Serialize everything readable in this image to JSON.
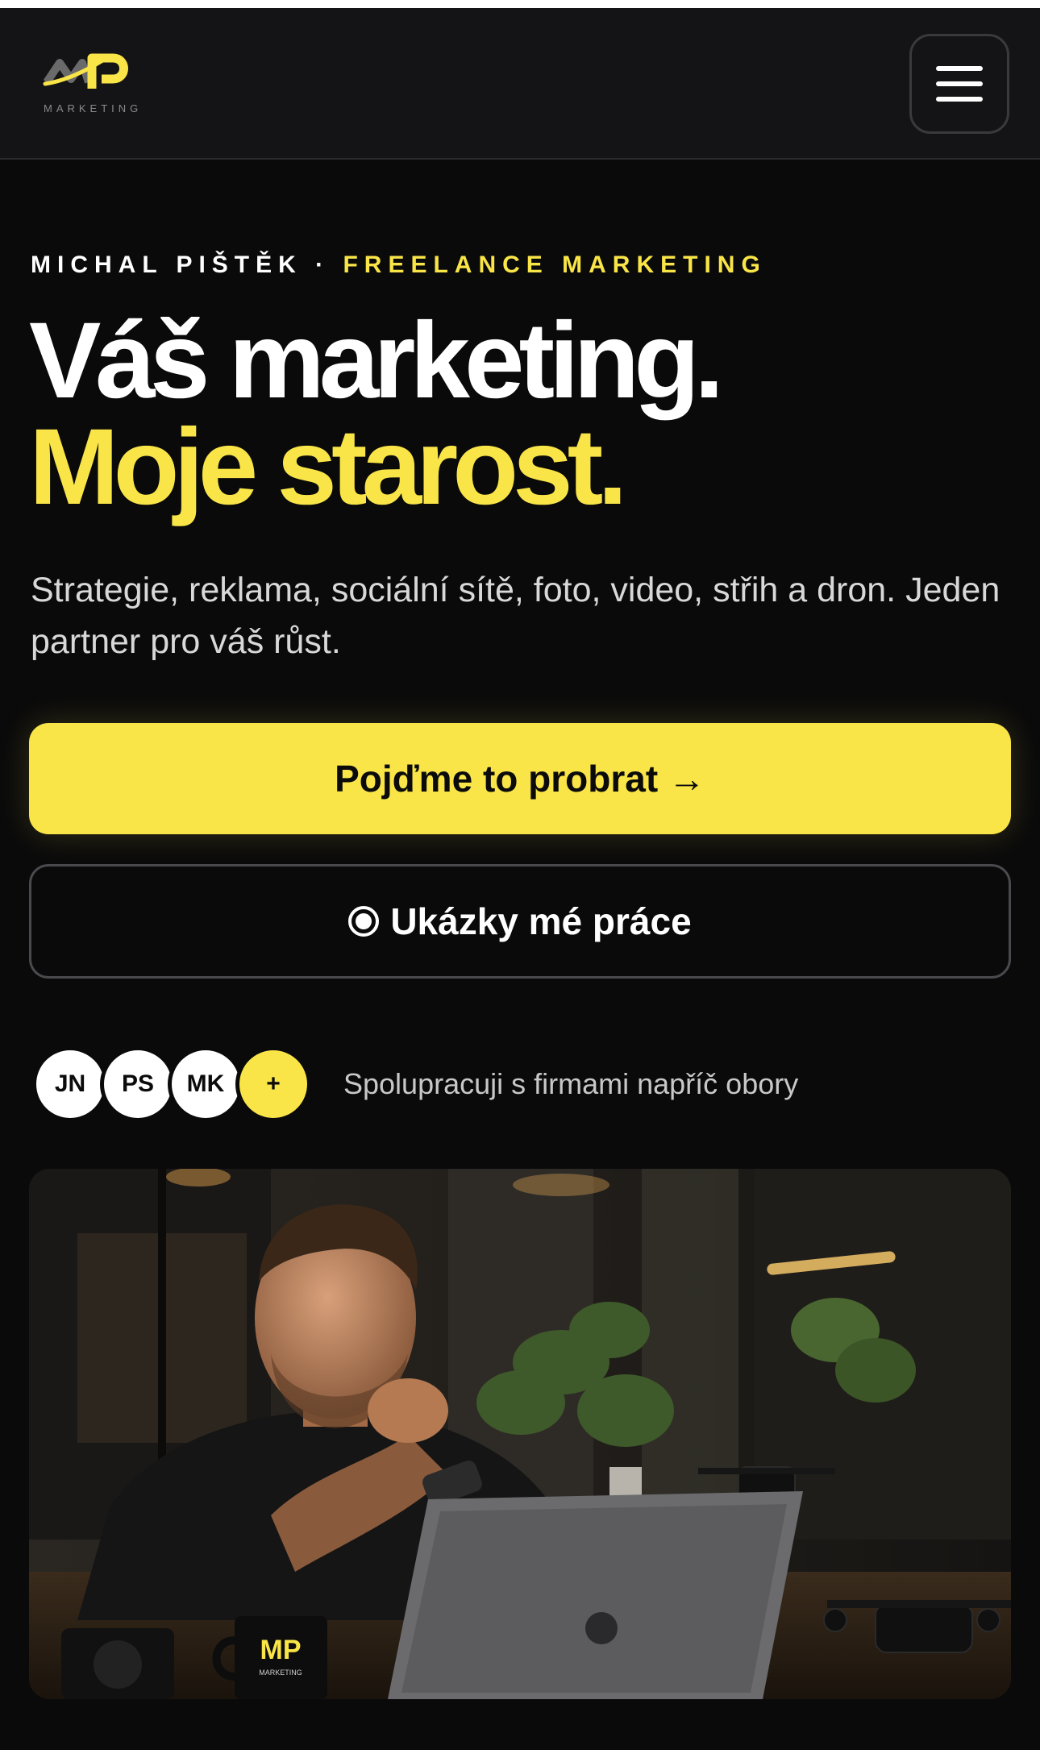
{
  "header": {
    "logo_letters": "MP",
    "logo_subtext": "MARKETING",
    "menu_icon": "hamburger-menu-icon"
  },
  "hero": {
    "eyebrow_name": "MICHAL PIŠTĚK ·",
    "eyebrow_accent": "FREELANCE MARKETING",
    "headline_line1": "Váš marketing.",
    "headline_line2": "Moje starost.",
    "subtitle": "Strategie, reklama, sociální sítě, foto, video, střih a dron. Jeden partner pro váš růst.",
    "cta_primary": "Pojďme to probrat →",
    "cta_secondary": "Ukázky mé práce"
  },
  "clients": {
    "avatars": [
      "JN",
      "PS",
      "MK",
      "+"
    ],
    "text": "Spolupracuji s firmami napříč obory"
  },
  "photo": {
    "mug_letters": "MP",
    "mug_subtext": "MARKETING"
  },
  "colors": {
    "accent": "#f9e547",
    "background": "#0a0a0b",
    "header": "#141416"
  }
}
